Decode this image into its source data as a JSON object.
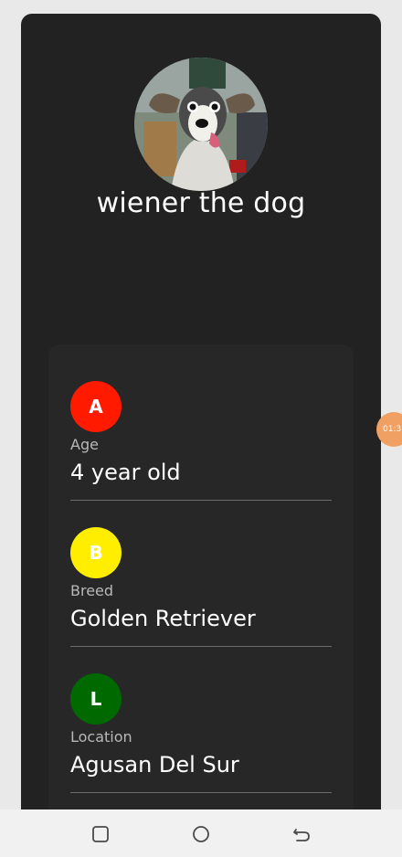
{
  "profile": {
    "name": "wiener the dog",
    "avatar_icon": "dog-photo"
  },
  "details": [
    {
      "letter": "A",
      "badge_color": "#ff1a00",
      "letter_color": "#ffffff",
      "label": "Age",
      "value": "4 year old"
    },
    {
      "letter": "B",
      "badge_color": "#ffee00",
      "letter_color": "#ffffff",
      "label": "Breed",
      "value": "Golden Retriever"
    },
    {
      "letter": "L",
      "badge_color": "#006a00",
      "letter_color": "#ffffff",
      "label": "Location",
      "value": "Agusan Del Sur"
    }
  ],
  "floating_timer": {
    "text": "01:3"
  },
  "nav_bar": {
    "recents_icon": "recents-icon",
    "home_icon": "home-icon",
    "back_icon": "back-icon"
  },
  "colors": {
    "card_background": "#222222",
    "page_background": "#e9e9e9",
    "timer_bubble": "#f0a062"
  }
}
